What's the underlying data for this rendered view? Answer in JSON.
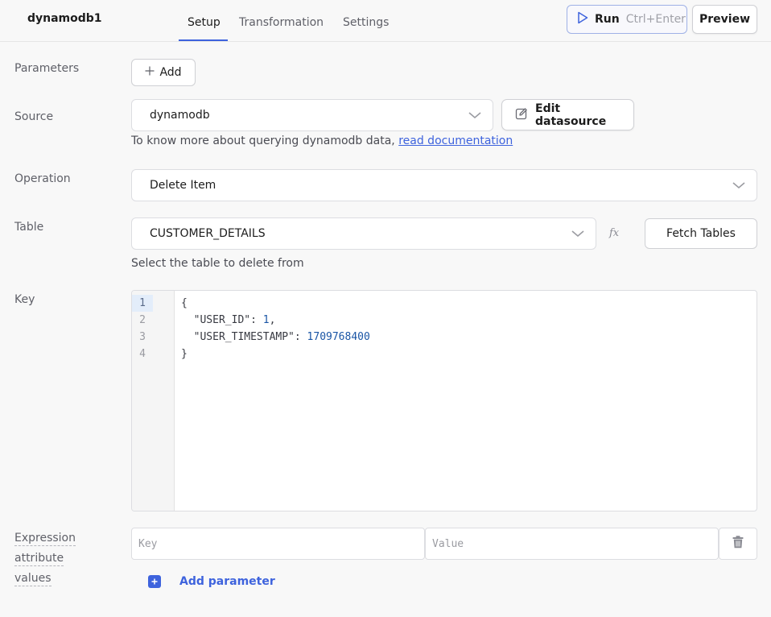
{
  "header": {
    "query_name": "dynamodb1",
    "tabs": [
      {
        "label": "Setup",
        "active": true
      },
      {
        "label": "Transformation",
        "active": false
      },
      {
        "label": "Settings",
        "active": false
      }
    ],
    "run_label": "Run",
    "run_shortcut": "Ctrl+Enter",
    "preview_label": "Preview"
  },
  "parameters": {
    "label": "Parameters",
    "add_label": "Add"
  },
  "source": {
    "label": "Source",
    "value": "dynamodb",
    "edit_label": "Edit datasource",
    "help_text": "To know more about querying dynamodb data, ",
    "help_link": "read documentation"
  },
  "operation": {
    "label": "Operation",
    "value": "Delete Item"
  },
  "table": {
    "label": "Table",
    "value": "CUSTOMER_DETAILS",
    "fx_label": "fx",
    "fetch_label": "Fetch Tables",
    "help_text": "Select the table to delete from"
  },
  "key": {
    "label": "Key",
    "line_numbers": [
      "1",
      "2",
      "3",
      "4"
    ],
    "lines": [
      {
        "text": "{"
      },
      {
        "key": "  \"USER_ID\": ",
        "number": "1",
        "suffix": ","
      },
      {
        "key": "  \"USER_TIMESTAMP\": ",
        "number": "1709768400",
        "suffix": ""
      },
      {
        "text": "}"
      }
    ]
  },
  "expression_attribute_values": {
    "label_lines": [
      "Expression",
      "attribute",
      "values"
    ],
    "key_placeholder": "Key",
    "value_placeholder": "Value",
    "add_parameter_label": "Add parameter"
  },
  "colors": {
    "accent": "#3e63dd",
    "background": "#f8f8f8",
    "code_number": "#1a55a5"
  }
}
